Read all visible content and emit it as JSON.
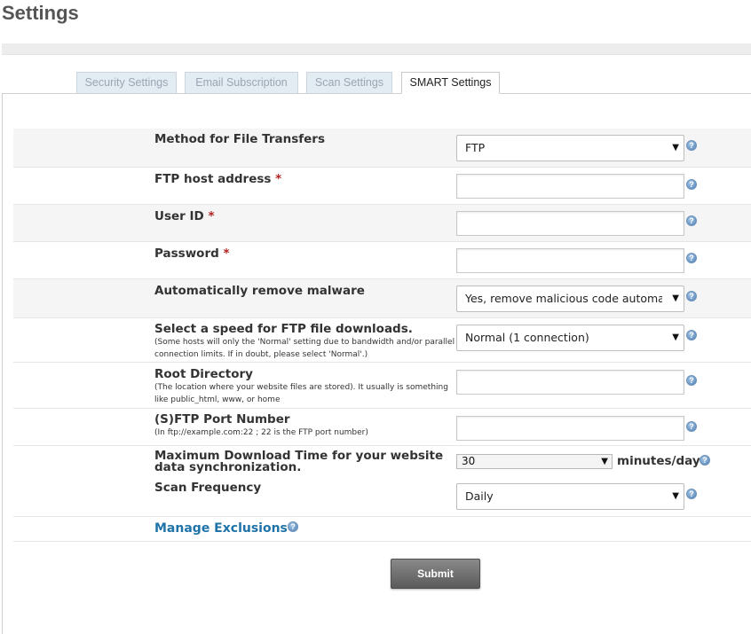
{
  "page": {
    "title": "Settings"
  },
  "tabs": [
    {
      "label": "Security Settings"
    },
    {
      "label": "Email Subscription"
    },
    {
      "label": "Scan Settings"
    },
    {
      "label": "SMART Settings",
      "active": true
    }
  ],
  "form": {
    "method": {
      "label": "Method for File Transfers",
      "value": "FTP"
    },
    "host": {
      "label": "FTP host address",
      "required": "*",
      "value": ""
    },
    "user": {
      "label": "User ID",
      "required": "*",
      "value": ""
    },
    "password": {
      "label": "Password",
      "required": "*",
      "value": ""
    },
    "malware": {
      "label": "Automatically remove malware",
      "value": "Yes, remove malicious code automatically"
    },
    "speed": {
      "label": "Select a speed for FTP file downloads.",
      "hint": "(Some hosts will only the 'Normal' setting due to bandwidth and/or parallel connection limits. If in doubt, please select 'Normal'.)",
      "value": "Normal (1 connection)"
    },
    "root": {
      "label": "Root Directory",
      "hint": "(The location where your website files are stored). It usually is something like public_html, www, or home",
      "value": ""
    },
    "port": {
      "label": "(S)FTP Port Number",
      "hint": "(In ftp://example.com:22 ; 22 is the FTP port number)",
      "value": ""
    },
    "maxtime": {
      "label": "Maximum Download Time for your website data synchronization.",
      "value": "30",
      "unit": "minutes/day"
    },
    "frequency": {
      "label": "Scan Frequency",
      "value": "Daily"
    },
    "exclusions": {
      "label": "Manage Exclusions"
    },
    "submit": {
      "label": "Submit"
    }
  },
  "icons": {
    "help": "question-help-icon",
    "dropdown": "caret-down-icon"
  },
  "colors": {
    "link": "#1f73a8",
    "required": "#b22222",
    "tab_inactive_bg": "#e3ebf3"
  }
}
